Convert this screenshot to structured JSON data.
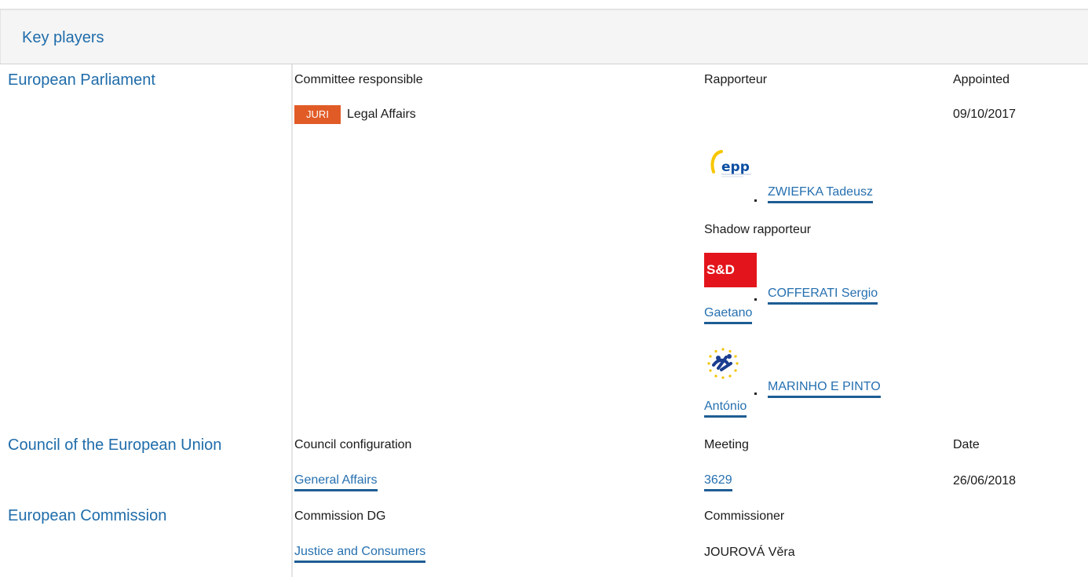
{
  "header": {
    "title": "Key players"
  },
  "parliament": {
    "institution": "European Parliament",
    "committee_header": "Committee responsible",
    "rapporteur_header": "Rapporteur",
    "appointed_header": "Appointed",
    "committee_badge": "JURI",
    "committee_name": "Legal Affairs",
    "appointed_date": "09/10/2017",
    "rapporteur_group_logo": "epp-logo",
    "rapporteur_name": "ZWIEFKA Tadeusz",
    "shadow_header": "Shadow rapporteur",
    "shadows": [
      {
        "group_logo": "sd-logo",
        "group_label": "S&D",
        "name_line1": "COFFERATI Sergio",
        "name_line2": "Gaetano"
      },
      {
        "group_logo": "alde-logo",
        "name_line1": "MARINHO E PINTO",
        "name_line2": "António"
      }
    ]
  },
  "council": {
    "institution": "Council of the European Union",
    "config_header": "Council configuration",
    "meeting_header": "Meeting",
    "date_header": "Date",
    "config_value": "General Affairs",
    "meeting_value": "3629",
    "date_value": "26/06/2018"
  },
  "commission": {
    "institution": "European Commission",
    "dg_header": "Commission DG",
    "commissioner_header": "Commissioner",
    "dg_value": "Justice and Consumers",
    "commissioner_value": "JOUROVÁ Věra"
  },
  "colors": {
    "accent": "#1f6caa",
    "link_underline": "#1e5d94",
    "badge": "#e15b27",
    "sd_red": "#e3141b"
  }
}
